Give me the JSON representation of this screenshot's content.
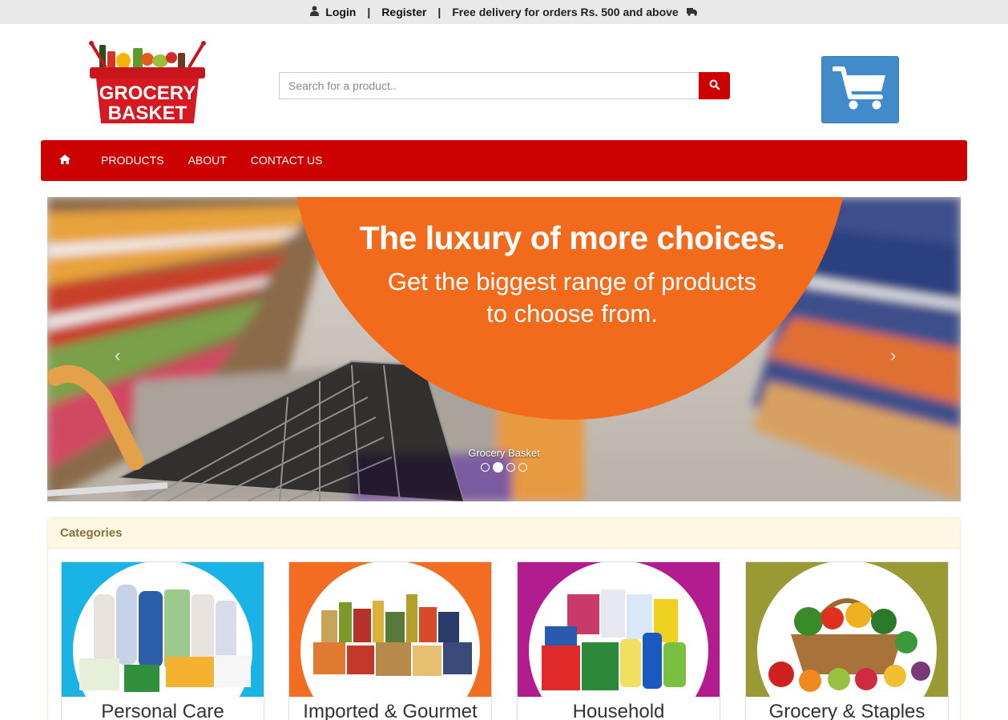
{
  "topbar": {
    "login": "Login",
    "register": "Register",
    "separator": "|",
    "delivery_text": "Free delivery for orders Rs. 500 and above",
    "icons": [
      "user-icon",
      "truck-icon"
    ]
  },
  "header": {
    "logo_text_line1": "GROCERY",
    "logo_text_line2": "BASKET",
    "search_placeholder": "Search for a product..",
    "search_icon": "search-icon",
    "cart_icon": "shopping-cart-icon"
  },
  "nav": {
    "home_icon": "home-icon",
    "items": [
      {
        "label": "PRODUCTS"
      },
      {
        "label": "ABOUT"
      },
      {
        "label": "CONTACT US"
      }
    ]
  },
  "carousel": {
    "title": "The luxury of more choices.",
    "subtitle_line1": "Get the biggest range of products",
    "subtitle_line2": "to choose from.",
    "caption": "Grocery Basket",
    "prev_arrow": "‹",
    "next_arrow": "›",
    "slide_count": 4,
    "active_index": 1
  },
  "categories": {
    "heading": "Categories",
    "items": [
      {
        "label": "Personal Care",
        "bg": "#1ab3e6"
      },
      {
        "label": "Imported & Gourmet",
        "bg": "#f26c21"
      },
      {
        "label": "Household",
        "bg": "#b21c8e"
      },
      {
        "label": "Grocery & Staples",
        "bg": "#9a9a34"
      }
    ]
  },
  "colors": {
    "brand_red": "#cc0000",
    "cart_blue": "#428bca",
    "panel_heading_bg": "#fcf8e3",
    "banner_orange": "#f26a1b"
  }
}
